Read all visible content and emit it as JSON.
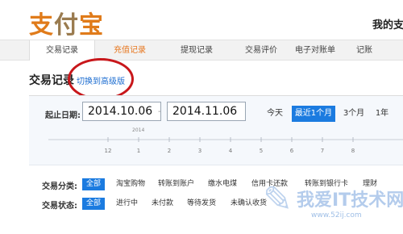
{
  "header": {
    "logo": {
      "left": "支",
      "mid": "付",
      "right": "宝"
    },
    "user_title": "我的支"
  },
  "tabs": [
    {
      "label": "交易记录",
      "state": "active"
    },
    {
      "label": "充值记录",
      "state": "highlight"
    },
    {
      "label": "提现记录",
      "state": "normal"
    },
    {
      "label": "交易评价",
      "state": "normal"
    },
    {
      "label": "电子对账单",
      "state": "normal"
    },
    {
      "label": "记账",
      "state": "normal"
    }
  ],
  "page": {
    "title": "交易记录",
    "switch_link": "切换到高级版"
  },
  "date_filter": {
    "label": "起止日期:",
    "start": "2014.10.06",
    "separator": "-",
    "end": "2014.11.06",
    "quick_options": [
      {
        "label": "今天",
        "active": false
      },
      {
        "label": "最近1个月",
        "active": true
      },
      {
        "label": "3个月",
        "active": false
      },
      {
        "label": "1年",
        "active": false
      }
    ]
  },
  "timeline": {
    "year": "2014",
    "ticks": [
      "12",
      "1",
      "2",
      "3",
      "4",
      "5",
      "6",
      "7",
      "8"
    ]
  },
  "category_filter": {
    "label": "交易分类:",
    "options": [
      {
        "label": "全部",
        "active": true
      },
      {
        "label": "淘宝购物",
        "active": false
      },
      {
        "label": "转账到账户",
        "active": false
      },
      {
        "label": "缴水电煤",
        "active": false
      },
      {
        "label": "信用卡还款",
        "active": false
      },
      {
        "label": "转账到银行卡",
        "active": false
      },
      {
        "label": "理财",
        "active": false
      }
    ]
  },
  "status_filter": {
    "label": "交易状态:",
    "options": [
      {
        "label": "全部",
        "active": true
      },
      {
        "label": "进行中",
        "active": false
      },
      {
        "label": "未付款",
        "active": false
      },
      {
        "label": "等待发货",
        "active": false
      },
      {
        "label": "未确认收货",
        "active": false
      }
    ]
  },
  "watermark": {
    "text": "我爱IT技术网",
    "url": "www.52ij.com"
  },
  "colors": {
    "accent_blue": "#1b7be0",
    "logo_orange": "#e07b1a",
    "annotation_red": "#c8171b",
    "tab_orange": "#e7761e"
  }
}
